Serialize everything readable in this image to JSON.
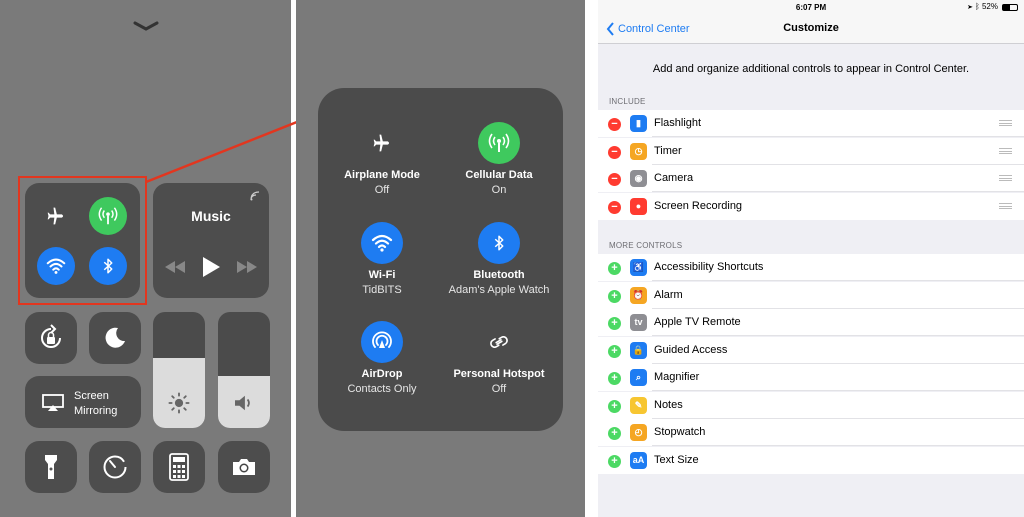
{
  "control_center": {
    "music_title": "Music",
    "screen_mirroring": [
      "Screen",
      "Mirroring"
    ]
  },
  "expanded": {
    "airplane": {
      "name": "Airplane Mode",
      "state": "Off"
    },
    "cellular": {
      "name": "Cellular Data",
      "state": "On"
    },
    "wifi": {
      "name": "Wi-Fi",
      "state": "TidBITS"
    },
    "bluetooth": {
      "name": "Bluetooth",
      "state": "Adam's Apple Watch"
    },
    "airdrop": {
      "name": "AirDrop",
      "state": "Contacts Only"
    },
    "hotspot": {
      "name": "Personal Hotspot",
      "state": "Off"
    }
  },
  "customize": {
    "status_time": "6:07 PM",
    "battery": "52%",
    "back_label": "Control Center",
    "title": "Customize",
    "intro": "Add and organize additional controls to appear in Control Center.",
    "include_header": "INCLUDE",
    "include": [
      {
        "name": "Flashlight",
        "icon": "flashlight-icon",
        "color": "#1e7cf2"
      },
      {
        "name": "Timer",
        "icon": "timer-icon",
        "color": "#f5a623"
      },
      {
        "name": "Camera",
        "icon": "camera-icon",
        "color": "#8e8e93"
      },
      {
        "name": "Screen Recording",
        "icon": "screen-recording-icon",
        "color": "#ff3b30"
      }
    ],
    "more_header": "MORE CONTROLS",
    "more": [
      {
        "name": "Accessibility Shortcuts",
        "icon": "accessibility-icon",
        "color": "#1e7cf2"
      },
      {
        "name": "Alarm",
        "icon": "alarm-icon",
        "color": "#f5a623"
      },
      {
        "name": "Apple TV Remote",
        "icon": "apple-tv-icon",
        "color": "#8e8e93"
      },
      {
        "name": "Guided Access",
        "icon": "lock-icon",
        "color": "#1e7cf2"
      },
      {
        "name": "Magnifier",
        "icon": "magnifier-icon",
        "color": "#1e7cf2"
      },
      {
        "name": "Notes",
        "icon": "notes-icon",
        "color": "#f7c631"
      },
      {
        "name": "Stopwatch",
        "icon": "stopwatch-icon",
        "color": "#f5a623"
      },
      {
        "name": "Text Size",
        "icon": "text-size-icon",
        "color": "#1e7cf2"
      }
    ],
    "colors": {
      "accent": "#1e7cf2",
      "remove": "#ff3b30",
      "add": "#4cd964"
    }
  }
}
